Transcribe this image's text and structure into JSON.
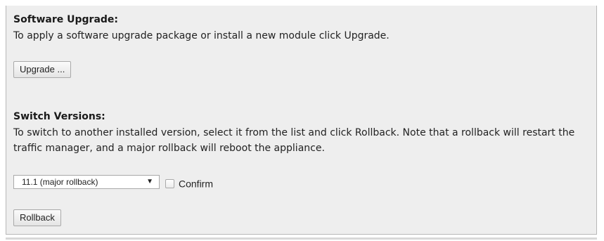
{
  "upgrade_section": {
    "title": "Software Upgrade:",
    "description": "To apply a software upgrade package or install a new module click Upgrade.",
    "button_label": "Upgrade ..."
  },
  "versions_section": {
    "title": "Switch Versions:",
    "description": "To switch to another installed version, select it from the list and click Rollback. Note that a rollback will restart the traffic manager, and a major rollback will reboot the appliance.",
    "version_select": {
      "selected": "11.1   (major rollback)",
      "arrow_icon": "▼"
    },
    "confirm_label": "Confirm",
    "confirm_checked": false,
    "rollback_label": "Rollback"
  }
}
